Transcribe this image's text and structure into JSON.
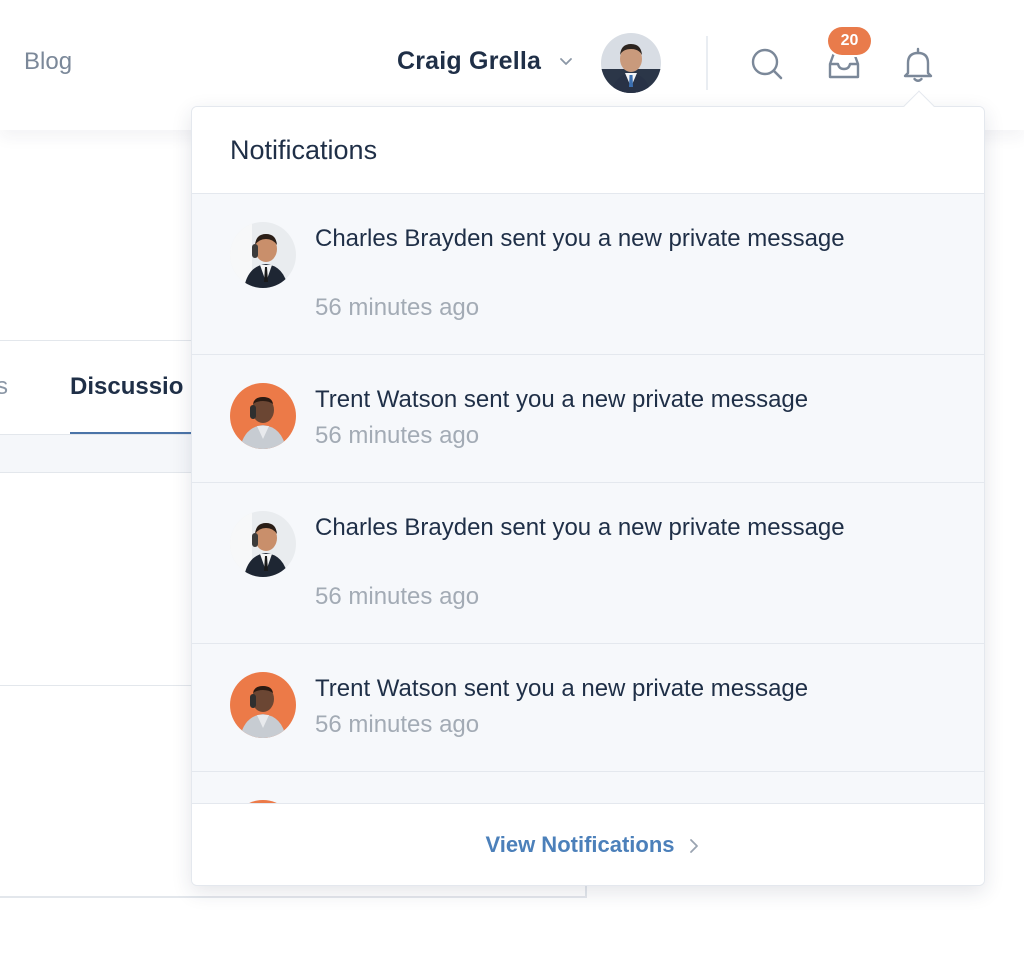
{
  "nav": {
    "blog": "Blog"
  },
  "user": {
    "name": "Craig Grella"
  },
  "inbox": {
    "badge_count": "20"
  },
  "background": {
    "tab_partial": "s",
    "tab_active": "Discussio"
  },
  "notifications": {
    "title": "Notifications",
    "items": [
      {
        "message": "Charles Brayden sent you a new private message",
        "time": "56 minutes ago",
        "avatar": "charles-brayden"
      },
      {
        "message": "Trent Watson sent you a new private message",
        "time": "56 minutes ago",
        "avatar": "trent-watson"
      },
      {
        "message": "Charles Brayden sent you a new private message",
        "time": "56 minutes ago",
        "avatar": "charles-brayden"
      },
      {
        "message": "Trent Watson sent you a new private message",
        "time": "56 minutes ago",
        "avatar": "trent-watson"
      }
    ],
    "footer_link": "View Notifications"
  },
  "colors": {
    "accent": "#4c80ba",
    "badge": "#e97b4b",
    "text_dark": "#1f2f47",
    "text_muted": "#a3abb5"
  }
}
